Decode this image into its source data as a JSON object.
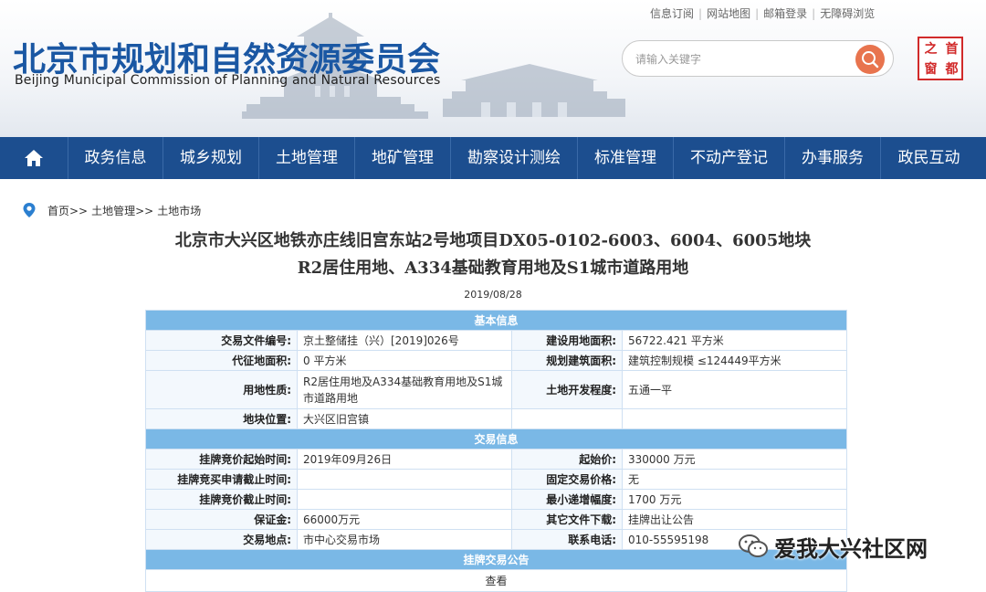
{
  "header": {
    "top_links": [
      "信息订阅",
      "网站地图",
      "邮箱登录",
      "无障碍浏览"
    ],
    "logo_cn": "北京市规划和自然资源委员会",
    "logo_en": "Beijing  Municipal  Commission  of  Planning  and  Natural  Resources",
    "search_placeholder": "请输入关键字",
    "seal_chars": [
      "之",
      "首",
      "窗",
      "都"
    ]
  },
  "nav": {
    "items": [
      "政务信息",
      "城乡规划",
      "土地管理",
      "地矿管理",
      "勘察设计测绘",
      "标准管理",
      "不动产登记",
      "办事服务",
      "政民互动"
    ]
  },
  "breadcrumb": [
    "首页>>",
    "土地管理>>",
    "土地市场"
  ],
  "article": {
    "title_line1": "北京市大兴区地铁亦庄线旧宫东站2号地项目DX05-0102-6003、6004、6005地块",
    "title_line2": "R2居住用地、A334基础教育用地及S1城市道路用地",
    "date": "2019/08/28"
  },
  "table": {
    "section_basic": "基本信息",
    "section_trade": "交易信息",
    "section_notice": "挂牌交易公告",
    "doc_no_label": "交易文件编号:",
    "doc_no_value": "京土整储挂（兴）[2019]026号",
    "build_area_label": "建设用地面积:",
    "build_area_value": "56722.421 平方米",
    "levy_area_label": "代征地面积:",
    "levy_area_value": "0 平方米",
    "plan_area_label": "规划建筑面积:",
    "plan_area_value": "建筑控制规模 ≤124449平方米",
    "land_use_label": "用地性质:",
    "land_use_value": "R2居住用地及A334基础教育用地及S1城市道路用地",
    "dev_label": "土地开发程度:",
    "dev_value": "五通一平",
    "location_label": "地块位置:",
    "location_value": "大兴区旧宫镇",
    "start_time_label": "挂牌竞价起始时间:",
    "start_time_value": "2019年09月26日",
    "start_price_label": "起始价:",
    "start_price_value": "330000 万元",
    "apply_deadline_label": "挂牌竞买申请截止时间:",
    "apply_deadline_value": "",
    "fixed_price_label": "固定交易价格:",
    "fixed_price_value": "无",
    "bid_deadline_label": "挂牌竞价截止时间:",
    "bid_deadline_value": "",
    "min_increment_label": "最小递增幅度:",
    "min_increment_value": "1700 万元",
    "deposit_label": "保证金:",
    "deposit_value": "66000万元",
    "other_docs_label": "其它文件下载:",
    "other_docs_value": "挂牌出让公告",
    "venue_label": "交易地点:",
    "venue_value": "市中心交易市场",
    "phone_label": "联系电话:",
    "phone_value": "010-55595198",
    "view_label": "查看"
  },
  "watermark": {
    "text": "爱我大兴社区网",
    "icon": "wechat-icon"
  },
  "colors": {
    "nav_bg": "#1c4e8f",
    "logo_blue": "#1a57a3",
    "section_bg": "#7ab8e6",
    "search_btn": "#e8744e",
    "seal_red": "#d12a2a"
  }
}
